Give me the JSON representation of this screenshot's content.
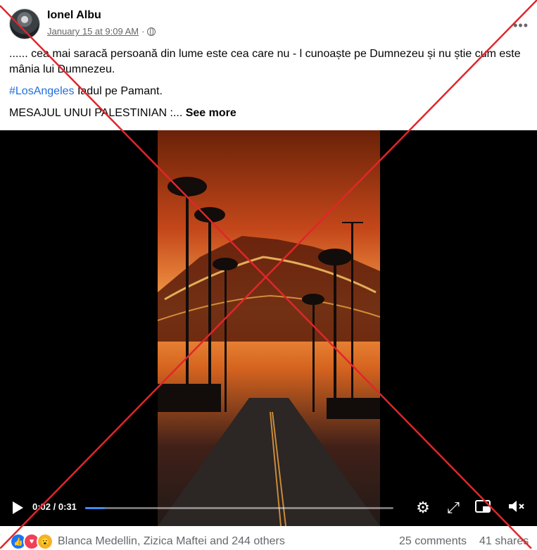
{
  "post": {
    "author": "Ionel Albu",
    "date": "January 15 at 9:09 AM",
    "separator": "·",
    "privacy_icon": "globe-icon",
    "more_icon": "more-options-icon",
    "text": {
      "line1": "...... cea mai saracă persoană din lume este cea care nu - l cunoaște pe Dumnezeu și nu știe cum este mânia lui Dumnezeu.",
      "hashtag": "#LosAngeles",
      "line2_rest": " Iadul pe Pamant.",
      "line3": "MESAJUL UNUI PALESTINIAN :...",
      "see_more": "See more"
    }
  },
  "video": {
    "time_label": "0:02 / 0:31",
    "progress": 0.065,
    "icons": [
      "play-icon",
      "settings-icon",
      "fullscreen-icon",
      "picture-in-picture-icon",
      "mute-icon"
    ]
  },
  "footer": {
    "reactions": [
      "like-icon",
      "love-icon",
      "wow-icon"
    ],
    "names": "Blanca Medellin, Zizica Maftei and 244 others",
    "comments": "25 comments",
    "shares": "41 shares"
  },
  "overlay": {
    "x_color": "#e0262b"
  },
  "colors": {
    "hashtag": "#216fdb",
    "progress": "#3d8bfd"
  }
}
